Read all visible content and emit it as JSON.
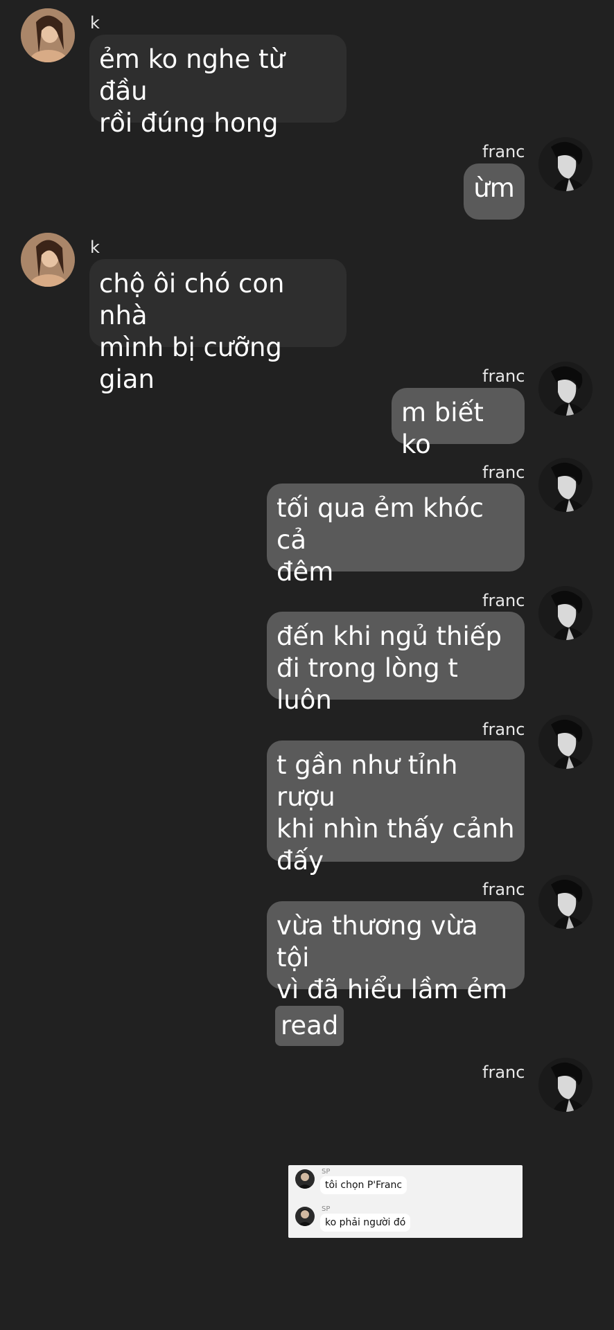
{
  "colors": {
    "background": "#212121",
    "incoming_bubble": "#2e2e2e",
    "outgoing_bubble": "#5a5a5a",
    "text": "#ffffff",
    "embed_background": "#f2f2f2"
  },
  "messages": [
    {
      "sender": "k",
      "side": "left",
      "avatar": "avatar-k",
      "text": "ẻm ko nghe từ đầu\nrồi đúng hong"
    },
    {
      "sender": "franc",
      "side": "right",
      "avatar": "avatar-franc",
      "text": "ừm"
    },
    {
      "sender": "k",
      "side": "left",
      "avatar": "avatar-k",
      "text": "chộ ôi chó con nhà\nmình bị cưỡng gian"
    },
    {
      "sender": "franc",
      "side": "right",
      "avatar": "avatar-franc",
      "text": "m biết ko"
    },
    {
      "sender": "franc",
      "side": "right",
      "avatar": "avatar-franc",
      "text": "tối qua ẻm khóc cả\nđêm"
    },
    {
      "sender": "franc",
      "side": "right",
      "avatar": "avatar-franc",
      "text": "đến khi ngủ thiếp\nđi trong lòng t luôn"
    },
    {
      "sender": "franc",
      "side": "right",
      "avatar": "avatar-franc",
      "text": "t gần như tỉnh rượu\nkhi nhìn thấy cảnh\nđấy"
    },
    {
      "sender": "franc",
      "side": "right",
      "avatar": "avatar-franc",
      "text": "vừa thương vừa tội\nvì đã hiểu lầm ẻm"
    }
  ],
  "status_label": "read",
  "last_sender": {
    "sender": "franc",
    "avatar": "avatar-franc"
  },
  "embedded_chat": {
    "messages": [
      {
        "sender": "SP",
        "text": "tôi chọn P'Franc"
      },
      {
        "sender": "SP",
        "text": "ko phải người đó"
      }
    ]
  }
}
